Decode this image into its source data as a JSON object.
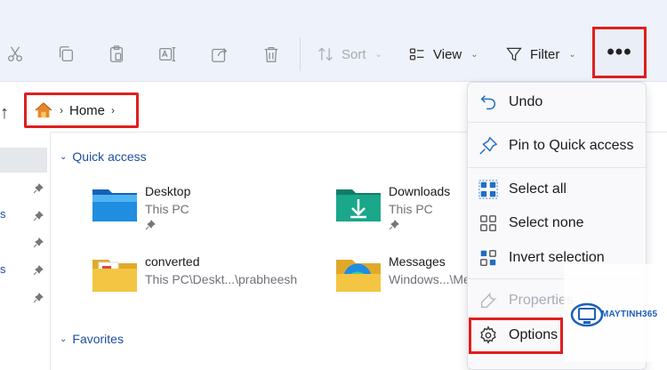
{
  "toolbar": {
    "sort_label": "Sort",
    "view_label": "View",
    "filter_label": "Filter",
    "more_label": "•••"
  },
  "address": {
    "home_label": "Home"
  },
  "nav": {
    "fragments": [
      "s",
      "s"
    ]
  },
  "quick_access": {
    "title": "Quick access",
    "items": [
      {
        "name": "Desktop",
        "location": "This PC"
      },
      {
        "name": "Downloads",
        "location": "This PC"
      },
      {
        "name": "converted",
        "location": "This PC\\Deskt...\\prabheesh"
      },
      {
        "name": "Messages",
        "location": "Windows...\\Me"
      }
    ]
  },
  "favorites": {
    "title": "Favorites"
  },
  "menu": {
    "items": [
      {
        "label": "Undo"
      },
      {
        "label": "Pin to Quick access"
      },
      {
        "label": "Select all"
      },
      {
        "label": "Select none"
      },
      {
        "label": "Invert selection"
      },
      {
        "label": "Properties"
      },
      {
        "label": "Options"
      }
    ]
  },
  "watermark": {
    "brand": "MAYTINH365"
  },
  "colors": {
    "highlight": "#e01e1e",
    "accent": "#1b4f9c",
    "folder_yellow": "#f4c542",
    "folder_teal": "#1aa78a",
    "folder_blue": "#1f7bd8"
  }
}
